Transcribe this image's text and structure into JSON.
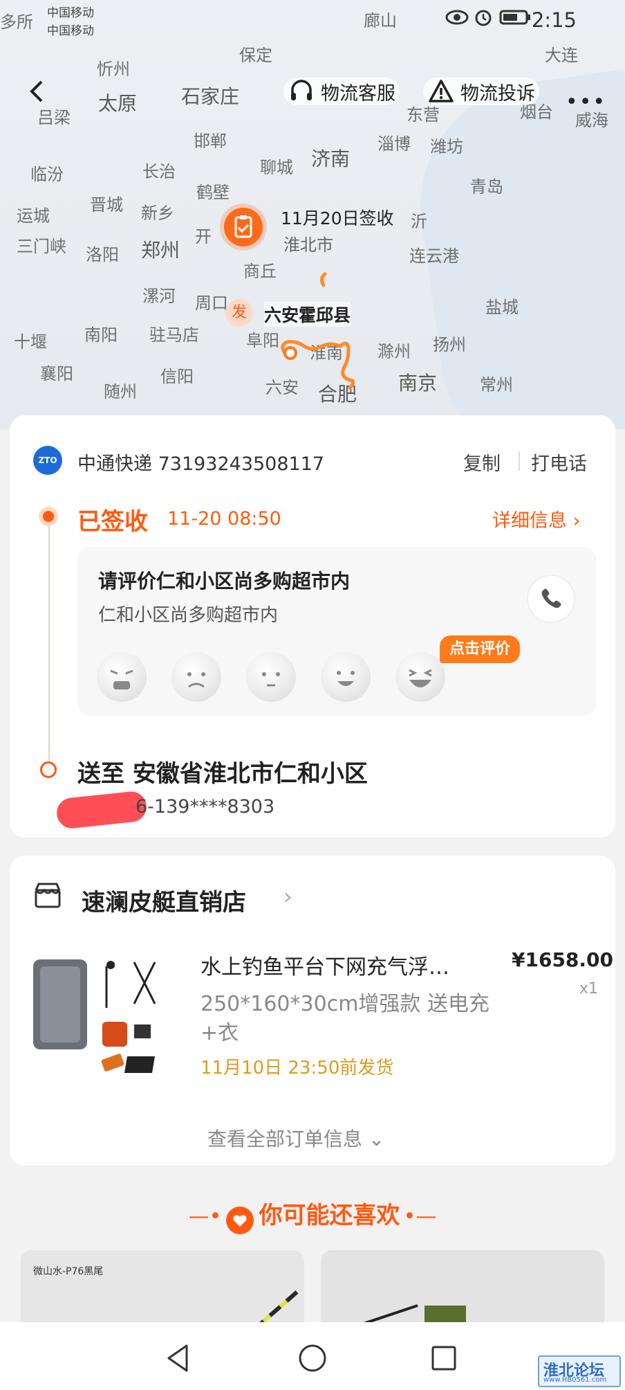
{
  "status_bar": {
    "carrier1": "中国移动",
    "carrier2": "中国移动",
    "time": "2:15"
  },
  "map": {
    "cities": [
      "多所",
      "忻州",
      "保定",
      "廊山",
      "大连",
      "太原",
      "石家庄",
      "吕梁",
      "东营",
      "烟台",
      "威海",
      "邯郸",
      "淄博",
      "潍坊",
      "济南",
      "临汾",
      "长治",
      "聊城",
      "青岛",
      "晋城",
      "鹤壁",
      "运城",
      "新乡",
      "三门峡",
      "洛阳",
      "郑州",
      "连云港",
      "漯河",
      "周口",
      "盐城",
      "十堰",
      "南阳",
      "驻马店",
      "淮南",
      "滁州",
      "扬州",
      "襄阳",
      "信阳",
      "六安",
      "合肥",
      "南京",
      "常州",
      "随州",
      "开",
      "商丘",
      "阜阳",
      "沂"
    ],
    "sign_date": "11月20日签收",
    "sign_city": "淮北市",
    "origin_badge": "发",
    "origin_name": "六安霍邱县"
  },
  "topbar": {
    "service": "物流客服",
    "complaint": "物流投诉",
    "more": "•••"
  },
  "logistics": {
    "courier": "中通快递 73193243508117",
    "copy": "复制",
    "call": "打电话",
    "status": "已签收",
    "status_time": "11-20 08:50",
    "detail": "详细信息 ›",
    "review_title": "请评价仁和小区尚多购超市内",
    "review_sub": "仁和小区尚多购超市内",
    "review_tag": "点击评价",
    "deliver_to": "送至 安徽省淮北市仁和小区",
    "phone": "6-139****8303"
  },
  "order": {
    "shop_name": "速澜皮艇直销店",
    "title": "水上钓鱼平台下网充气浮…",
    "price": "¥1658.00",
    "qty": "x1",
    "spec": "250*160*30cm增强款 送电充+衣",
    "ship": "11月10日 23:50前发货",
    "view_all": "查看全部订单信息 ⌄"
  },
  "recommend": {
    "title": "你可能还喜欢",
    "item1_label": "微山水-P76黑尾"
  },
  "watermark": {
    "title": "淮北论坛",
    "url": "www.HB0561.com"
  },
  "colors": {
    "accent": "#ff5a0f",
    "ship_text": "#e09a1c",
    "courier_blue": "#1d6bd8"
  }
}
